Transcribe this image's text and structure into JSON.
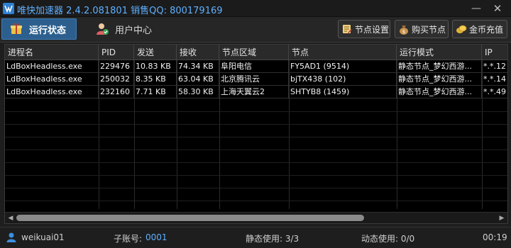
{
  "window": {
    "title": "唯快加速器 2.4.2.081801 销售QQ: 800179169",
    "minimize_glyph": "—",
    "close_glyph": "✕"
  },
  "toolbar": {
    "tabs": [
      {
        "label": "运行状态",
        "icon": "gift-icon",
        "active": true
      },
      {
        "label": "用户中心",
        "icon": "user-center-icon",
        "active": false
      }
    ],
    "buttons": [
      {
        "label": "节点设置",
        "icon": "node-settings-icon"
      },
      {
        "label": "购买节点",
        "icon": "money-bag-icon"
      },
      {
        "label": "金币充值",
        "icon": "coins-icon"
      }
    ]
  },
  "table": {
    "columns": [
      "进程名",
      "PID",
      "发送",
      "接收",
      "节点区域",
      "节点",
      "运行模式",
      "IP"
    ],
    "rows": [
      [
        "LdBoxHeadless.exe",
        "229476",
        "10.83 KB",
        "74.34 KB",
        "阜阳电信",
        "FY5AD1 (9514)",
        "静态节点_梦幻西游...",
        "*.*.12"
      ],
      [
        "LdBoxHeadless.exe",
        "250032",
        "8.35 KB",
        "63.04 KB",
        "北京腾讯云",
        "bjTX438 (102)",
        "静态节点_梦幻西游...",
        "*.*.14"
      ],
      [
        "LdBoxHeadless.exe",
        "232160",
        "7.71 KB",
        "58.30 KB",
        "上海天翼云2",
        "SHTYB8 (1459)",
        "静态节点_梦幻西游...",
        "*.*.49"
      ]
    ],
    "scroll_left_glyph": "◀",
    "scroll_right_glyph": "▶"
  },
  "status": {
    "username": "weikuai01",
    "sub_account_label": "子账号:",
    "sub_account_value": "0001",
    "static_usage": "静态使用: 3/3",
    "dynamic_usage": "动态使用: 0/0",
    "timer": "00:19"
  },
  "colors": {
    "accent": "#5fb0ff",
    "active_tab": "#2c5f8e",
    "background": "#1e1e1e"
  }
}
